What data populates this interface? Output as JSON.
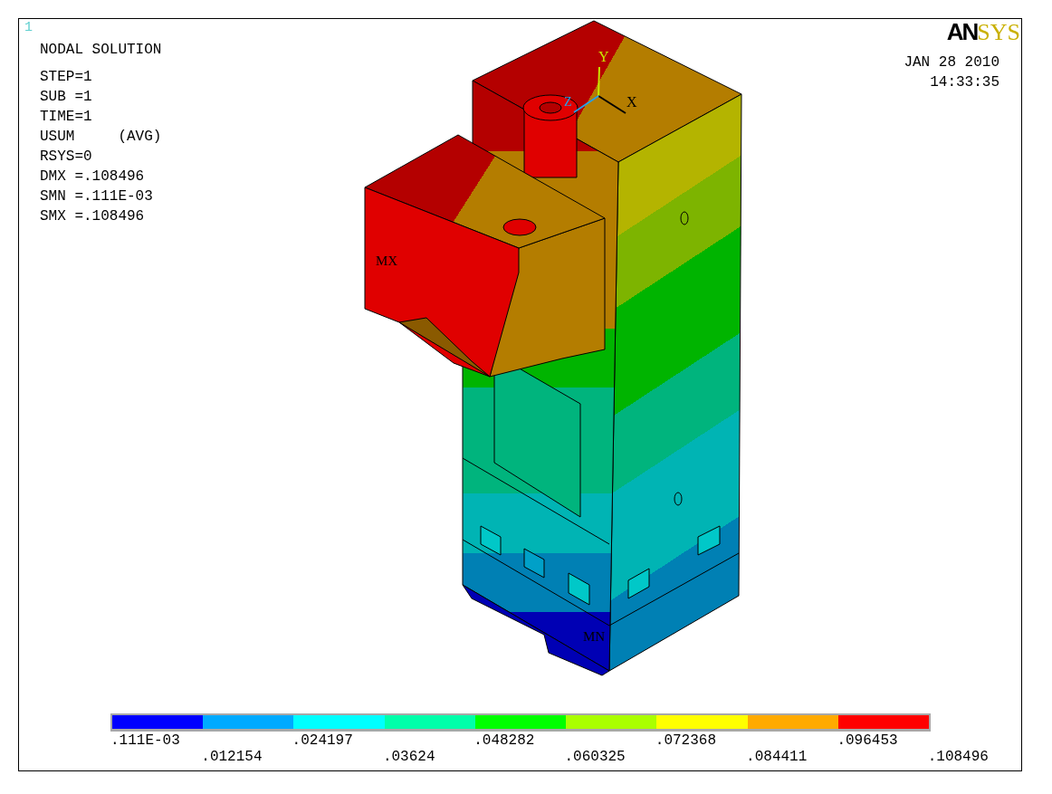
{
  "plot_number": "1",
  "title": "NODAL SOLUTION",
  "info_lines": [
    "STEP=1",
    "SUB =1",
    "TIME=1",
    "USUM     (AVG)",
    "RSYS=0",
    "DMX =.108496",
    "SMN =.111E-03",
    "SMX =.108496"
  ],
  "logo": [
    "AN",
    "SYS"
  ],
  "date": "JAN 28 2010",
  "time": "14:33:35",
  "axes": [
    "X",
    "Y",
    "Z"
  ],
  "max_label": "MX",
  "min_label": "MN",
  "legend": {
    "bands": [
      {
        "color": "#0000ff"
      },
      {
        "color": "#00aaff"
      },
      {
        "color": "#00ffff"
      },
      {
        "color": "#00ffaa"
      },
      {
        "color": "#00ff00"
      },
      {
        "color": "#aaff00"
      },
      {
        "color": "#ffff00"
      },
      {
        "color": "#ffaa00"
      },
      {
        "color": "#ff0000"
      }
    ],
    "labels": [
      ".111E-03",
      ".012154",
      ".024197",
      ".03624",
      ".048282",
      ".060325",
      ".072368",
      ".084411",
      ".096453",
      ".108496"
    ]
  }
}
